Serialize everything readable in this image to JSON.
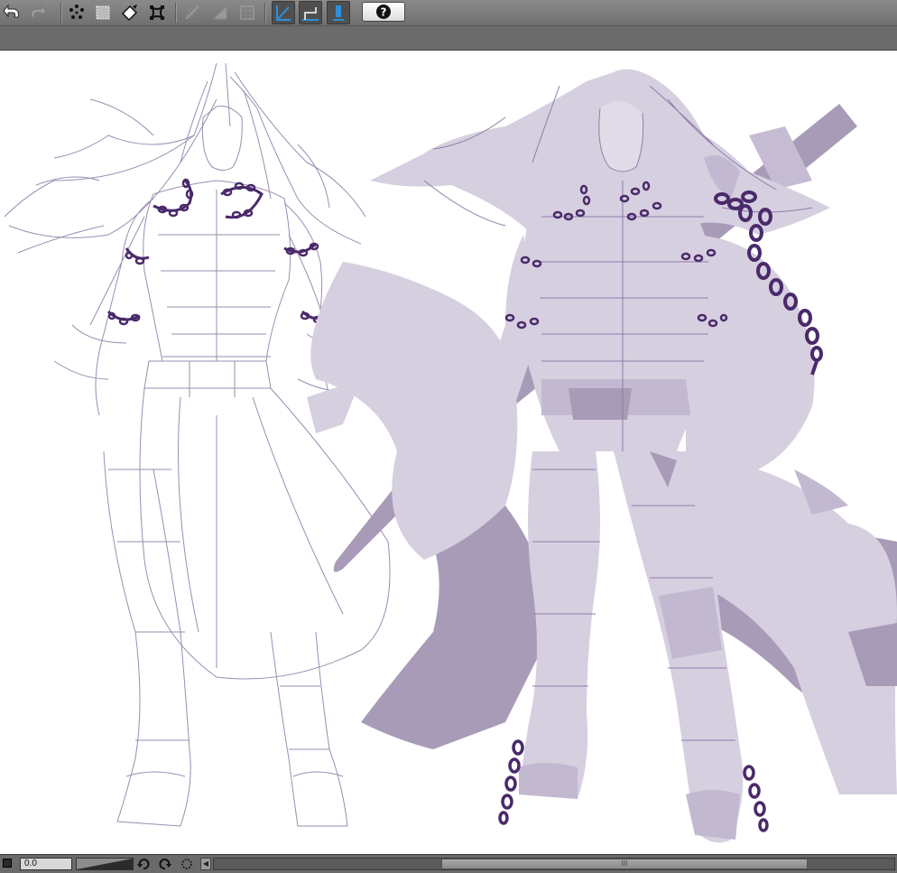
{
  "toolbar": {
    "help_label": "?",
    "icons": [
      "undo-icon",
      "redo-icon",
      "selection-options-icon",
      "deselect-icon",
      "fill-icon",
      "transform-icon",
      "grid-icon",
      "ruler-icon",
      "frame-icon",
      "snap-to-line-icon",
      "snap-to-ruler-icon",
      "snap-to-grid-icon",
      "help-icon"
    ]
  },
  "status": {
    "zoom_value": "0.0",
    "scroll_thumb_label": "III"
  },
  "colors": {
    "toolbar_bg": "#7a7a7a",
    "accent_blue": "#2f8fd8",
    "sketch_line": "#8e7ea8",
    "fill_light": "#d6cfe0",
    "fill_dark": "#a89bb8",
    "chain": "#4a2a6a"
  }
}
